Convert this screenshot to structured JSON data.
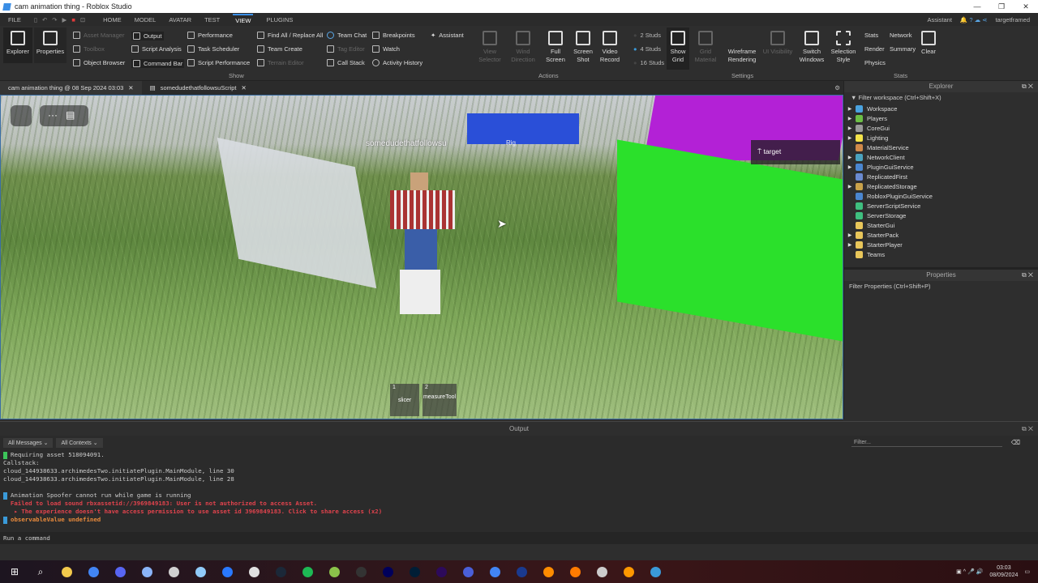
{
  "window": {
    "title": "cam animation thing - Roblox Studio"
  },
  "menubar": {
    "items": [
      "FILE",
      "HOME",
      "MODEL",
      "AVATAR",
      "TEST",
      "VIEW",
      "PLUGINS"
    ],
    "active": "VIEW",
    "assistant": "Assistant",
    "user": "targetframed"
  },
  "ribbon": {
    "explorer": "Explorer",
    "properties": "Properties",
    "col1": [
      "Asset Manager",
      "Toolbox",
      "Object Browser"
    ],
    "col2": [
      "Output",
      "Script Analysis",
      "Command Bar"
    ],
    "col3": [
      "Performance",
      "Task Scheduler",
      "Script Performance"
    ],
    "col4": [
      "Find All / Replace All",
      "Team Create",
      "Terrain Editor"
    ],
    "col5": [
      "Team Chat",
      "Tag Editor",
      "Call Stack"
    ],
    "col6": [
      "Breakpoints",
      "Watch",
      "Activity History"
    ],
    "assistant": "Assistant",
    "show_group": "Show",
    "view_selector": "View Selector",
    "wind_direction": "Wind Direction",
    "full_screen": "Full Screen",
    "screen_shot": "Screen Shot",
    "video_record": "Video Record",
    "actions_group": "Actions",
    "studs": [
      "2 Studs",
      "4 Studs",
      "16 Studs"
    ],
    "selected_studs": "4 Studs",
    "show_grid": "Show Grid",
    "grid_material": "Grid Material",
    "wireframe": "Wireframe Rendering",
    "ui_visibility": "UI Visibility",
    "switch_windows": "Switch Windows",
    "selection_style": "Selection Style",
    "settings_group": "Settings",
    "stats": [
      "Stats",
      "Network",
      "Render",
      "Summary",
      "Physics"
    ],
    "clear": "Clear",
    "stats_group": "Stats"
  },
  "tabs": [
    {
      "label": "cam animation thing @ 08 Sep 2024 03:03"
    },
    {
      "label": "somedudethatfollowsuScript"
    }
  ],
  "viewport": {
    "player_name": "somedudethatfollowsu",
    "rig_label": "Rig",
    "target_label": "target",
    "hotbar": [
      {
        "num": "1",
        "label": "slicer"
      },
      {
        "num": "2",
        "label": "measureTool"
      }
    ]
  },
  "explorer": {
    "title": "Explorer",
    "filter": "Filter workspace (Ctrl+Shift+X)",
    "items": [
      {
        "name": "Workspace",
        "color": "#4aa3df",
        "arrow": true
      },
      {
        "name": "Players",
        "color": "#6cbf45",
        "arrow": true
      },
      {
        "name": "CoreGui",
        "color": "#999",
        "arrow": true
      },
      {
        "name": "Lighting",
        "color": "#f3e34a",
        "arrow": true
      },
      {
        "name": "MaterialService",
        "color": "#d08a4a",
        "arrow": false
      },
      {
        "name": "NetworkClient",
        "color": "#4aa3bf",
        "arrow": true
      },
      {
        "name": "PluginGuiService",
        "color": "#4a86d0",
        "arrow": true
      },
      {
        "name": "ReplicatedFirst",
        "color": "#6a8ad0",
        "arrow": false
      },
      {
        "name": "ReplicatedStorage",
        "color": "#c9a24a",
        "arrow": true
      },
      {
        "name": "RobloxPluginGuiService",
        "color": "#4a86d0",
        "arrow": false
      },
      {
        "name": "ServerScriptService",
        "color": "#3fbf7f",
        "arrow": false
      },
      {
        "name": "ServerStorage",
        "color": "#3fbf7f",
        "arrow": false
      },
      {
        "name": "StarterGui",
        "color": "#e8c65a",
        "arrow": false
      },
      {
        "name": "StarterPack",
        "color": "#e8c65a",
        "arrow": true
      },
      {
        "name": "StarterPlayer",
        "color": "#e8c65a",
        "arrow": true
      },
      {
        "name": "Teams",
        "color": "#e8c65a",
        "arrow": false
      }
    ]
  },
  "properties": {
    "title": "Properties",
    "filter": "Filter Properties (Ctrl+Shift+P)"
  },
  "output": {
    "title": "Output",
    "messages_filter": "All Messages",
    "contexts_filter": "All Contexts",
    "filter_placeholder": "Filter...",
    "lines": [
      {
        "text": "Requiring asset 518094091.",
        "type": "info",
        "marker": "#3cc45a"
      },
      {
        "text": "Callstack:",
        "type": "plain"
      },
      {
        "text": "cloud_144938633.archimedesTwo.initiatePlugin.MainModule, line 30",
        "type": "plain"
      },
      {
        "text": "cloud_144938633.archimedesTwo.initiatePlugin.MainModule, line 28",
        "type": "plain"
      },
      {
        "text": "",
        "type": "plain"
      },
      {
        "text": "Animation Spoofer cannot run while game is running",
        "type": "info",
        "marker": "#3a9ad9"
      },
      {
        "text": "  Failed to load sound rbxassetid://3969849183: User is not authorized to access Asset.",
        "type": "red"
      },
      {
        "text": "   ▸ The experience doesn't have access permission to use asset id 3969849183. Click to share access (x2)",
        "type": "red"
      },
      {
        "text": "observableValue undefined",
        "type": "orange",
        "marker": "#3a9ad9"
      }
    ]
  },
  "command_bar": {
    "placeholder": "Run a command"
  },
  "taskbar": {
    "time": "03:03",
    "date": "08/09/2024"
  }
}
